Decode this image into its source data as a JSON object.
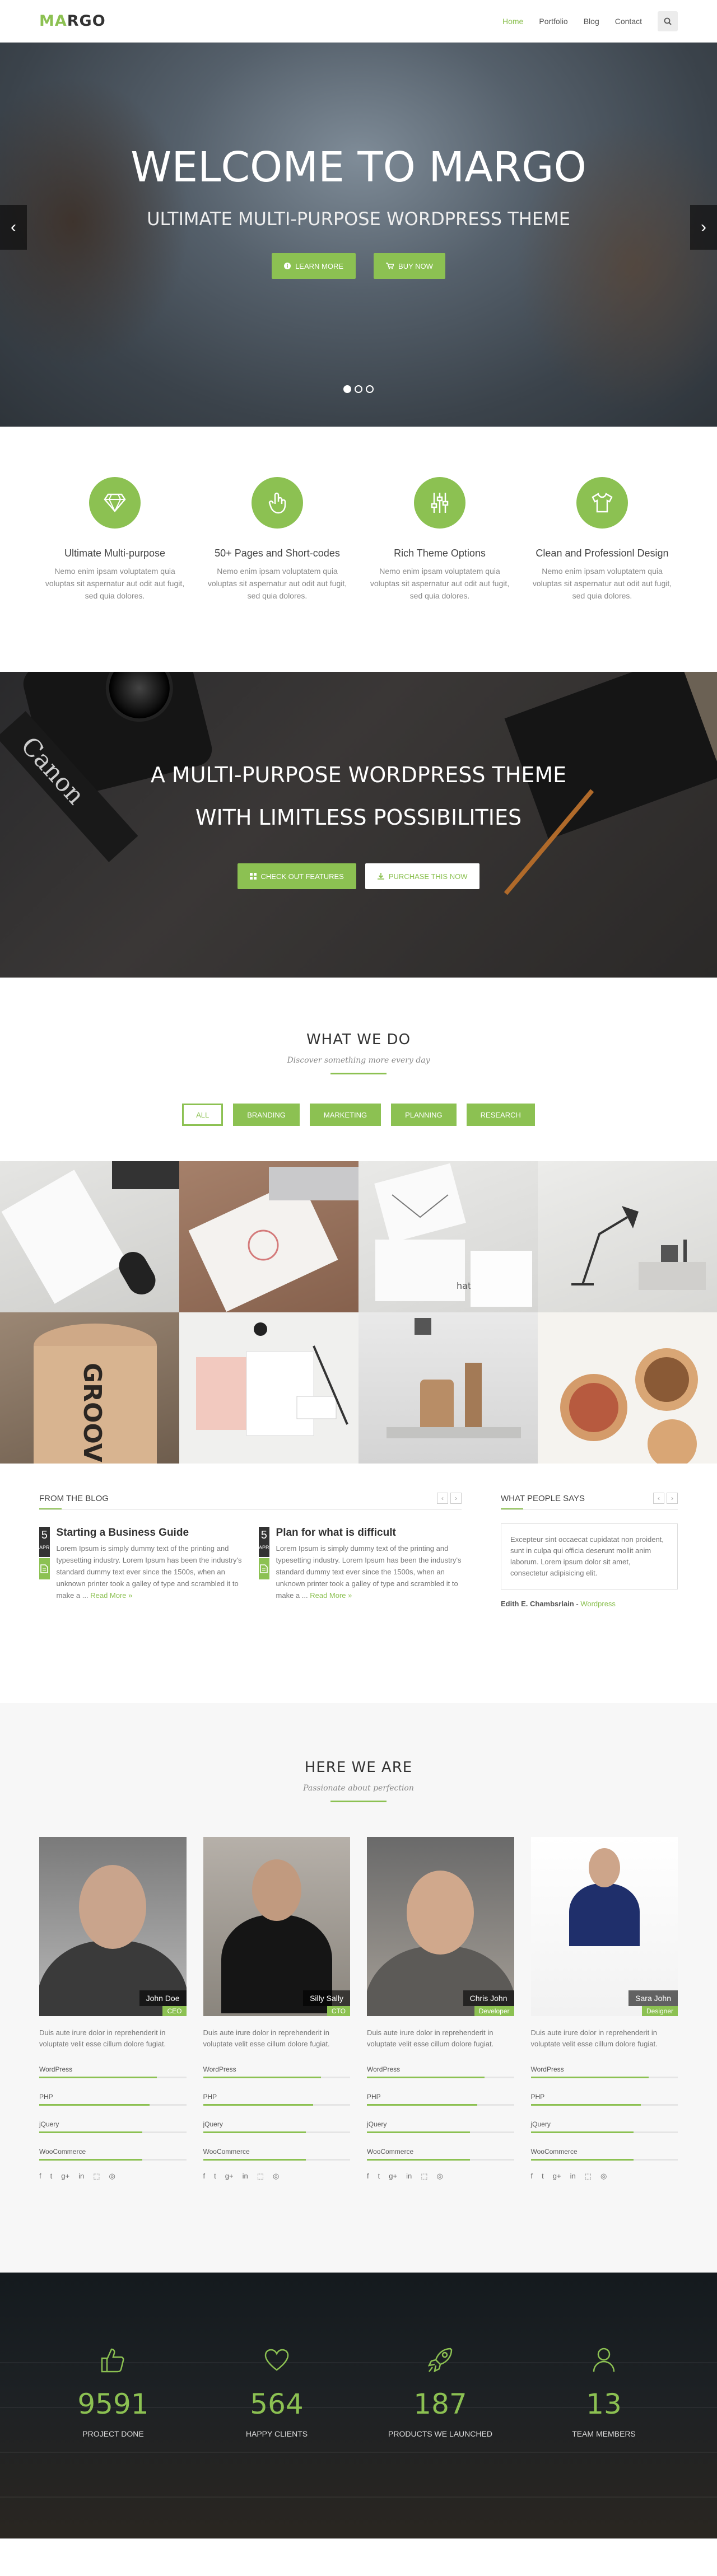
{
  "nav": {
    "logo_accent": "MA",
    "logo_rest": "RGO",
    "items": [
      {
        "label": "Home",
        "active": true
      },
      {
        "label": "Portfolio",
        "active": false
      },
      {
        "label": "Blog",
        "active": false
      },
      {
        "label": "Contact",
        "active": false
      }
    ]
  },
  "hero": {
    "title": "WELCOME TO MARGO",
    "subtitle": "ULTIMATE MULTI-PURPOSE WORDPRESS THEME",
    "btn_learn": "LEARN MORE",
    "btn_buy": "BUY NOW",
    "prev": "‹",
    "next": "›"
  },
  "features": [
    {
      "icon": "diamond-icon",
      "title": "Ultimate Multi-purpose",
      "text": "Nemo enim ipsam voluptatem quia voluptas sit aspernatur aut odit aut fugit, sed quia dolores."
    },
    {
      "icon": "hand-icon",
      "title": "50+ Pages and Short-codes",
      "text": "Nemo enim ipsam voluptatem quia voluptas sit aspernatur aut odit aut fugit, sed quia dolores."
    },
    {
      "icon": "sliders-icon",
      "title": "Rich Theme Options",
      "text": "Nemo enim ipsam voluptatem quia voluptas sit aspernatur aut odit aut fugit, sed quia dolores."
    },
    {
      "icon": "shirt-icon",
      "title": "Clean and Professionl Design",
      "text": "Nemo enim ipsam voluptatem quia voluptas sit aspernatur aut odit aut fugit, sed quia dolores."
    }
  ],
  "banner": {
    "line1": "A MULTI-PURPOSE WORDPRESS THEME",
    "line2": "WITH LIMITLESS POSSIBILITIES",
    "btn_features": "CHECK OUT FEATURES",
    "btn_purchase": "PURCHASE THIS NOW",
    "camera_brand": "Canon"
  },
  "whatwedo": {
    "title": "WHAT WE DO",
    "subtitle": "Discover something more every day",
    "filters": [
      "ALL",
      "BRANDING",
      "MARKETING",
      "PLANNING",
      "RESEARCH"
    ],
    "mug_text": "GROOVE",
    "card_text": "hatch"
  },
  "blog": {
    "heading": "FROM THE BLOG",
    "posts": [
      {
        "day": "5",
        "month": "APR",
        "title": "Starting a Business Guide",
        "text": "Lorem Ipsum is simply dummy text of the printing and typesetting industry. Lorem Ipsum has been the industry's standard dummy text ever since the 1500s, when an unknown printer took a galley of type and scrambled it to make a ...",
        "more": "Read More »"
      },
      {
        "day": "5",
        "month": "APR",
        "title": "Plan for what is difficult",
        "text": "Lorem Ipsum is simply dummy text of the printing and typesetting industry. Lorem Ipsum has been the industry's standard dummy text ever since the 1500s, when an unknown printer took a galley of type and scrambled it to make a ...",
        "more": "Read More »"
      }
    ]
  },
  "testimonial": {
    "heading": "WHAT PEOPLE SAYS",
    "quote": "Excepteur sint occaecat cupidatat non proident, sunt in culpa qui officia deserunt mollit anim laborum. Lorem ipsum dolor sit amet, consectetur adipisicing elit.",
    "author": "Edith E. Chambsrlain",
    "company": "Wordpress"
  },
  "team": {
    "title": "HERE WE ARE",
    "subtitle": "Passionate about perfection",
    "members": [
      {
        "name": "John Doe",
        "role": "CEO",
        "text": "Duis aute irure dolor in reprehenderit in voluptate velit esse cillum dolore fugiat.",
        "skills": [
          {
            "name": "WordPress",
            "level": 0.8
          },
          {
            "name": "PHP",
            "level": 0.75
          },
          {
            "name": "jQuery",
            "level": 0.7
          },
          {
            "name": "WooCommerce",
            "level": 0.7
          }
        ]
      },
      {
        "name": "Silly Sally",
        "role": "CTO",
        "text": "Duis aute irure dolor in reprehenderit in voluptate velit esse cillum dolore fugiat.",
        "skills": [
          {
            "name": "WordPress",
            "level": 0.8
          },
          {
            "name": "PHP",
            "level": 0.75
          },
          {
            "name": "jQuery",
            "level": 0.7
          },
          {
            "name": "WooCommerce",
            "level": 0.7
          }
        ]
      },
      {
        "name": "Chris John",
        "role": "Developer",
        "text": "Duis aute irure dolor in reprehenderit in voluptate velit esse cillum dolore fugiat.",
        "skills": [
          {
            "name": "WordPress",
            "level": 0.8
          },
          {
            "name": "PHP",
            "level": 0.75
          },
          {
            "name": "jQuery",
            "level": 0.7
          },
          {
            "name": "WooCommerce",
            "level": 0.7
          }
        ]
      },
      {
        "name": "Sara John",
        "role": "Designer",
        "text": "Duis aute irure dolor in reprehenderit in voluptate velit esse cillum dolore fugiat.",
        "skills": [
          {
            "name": "WordPress",
            "level": 0.8
          },
          {
            "name": "PHP",
            "level": 0.75
          },
          {
            "name": "jQuery",
            "level": 0.7
          },
          {
            "name": "WooCommerce",
            "level": 0.7
          }
        ]
      }
    ],
    "social_glyphs": [
      "f",
      "t",
      "g+",
      "in",
      "⬚",
      "◎"
    ]
  },
  "stats": [
    {
      "icon": "thumbs-up-icon",
      "value": "9591",
      "label": "PROJECT DONE"
    },
    {
      "icon": "heart-icon",
      "value": "564",
      "label": "HAPPY CLIENTS"
    },
    {
      "icon": "rocket-icon",
      "value": "187",
      "label": "PRODUCTS WE LAUNCHED"
    },
    {
      "icon": "user-icon",
      "value": "13",
      "label": "TEAM MEMBERS"
    }
  ],
  "colors": {
    "accent": "#8cc152",
    "dark": "#333333"
  }
}
